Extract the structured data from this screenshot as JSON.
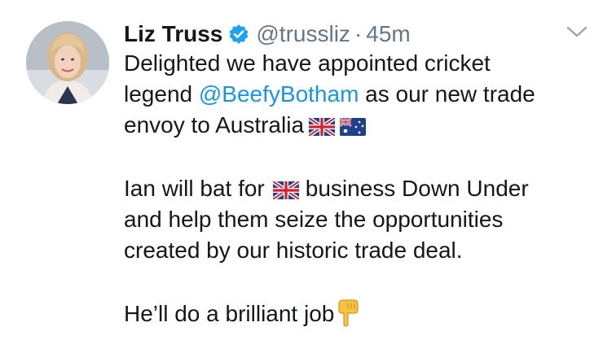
{
  "author": {
    "name": "Liz Truss",
    "handle": "@trussliz",
    "separator": "·",
    "time": "45m"
  },
  "tweet": {
    "line1": "Delighted we have appointed cricket",
    "line2_pre": "legend ",
    "mention": "@BeefyBotham",
    "line2_post": " as our new trade",
    "line3": "envoy to Australia",
    "line4_pre": "Ian will bat for",
    "line4_post": "business Down Under",
    "line5": "and help them seize the opportunities",
    "line6": "created by our historic trade deal.",
    "line7": "He’ll do a brilliant job"
  },
  "icons": {
    "verified": "verified-badge-icon",
    "caret": "chevron-down-icon",
    "flag_uk": "uk-flag-icon",
    "flag_au": "australia-flag-icon",
    "pointing": "pointing-down-hand-icon"
  },
  "colors": {
    "text": "#14171a",
    "secondary": "#657786",
    "link": "#1b95e0",
    "verified": "#1da1f2"
  }
}
